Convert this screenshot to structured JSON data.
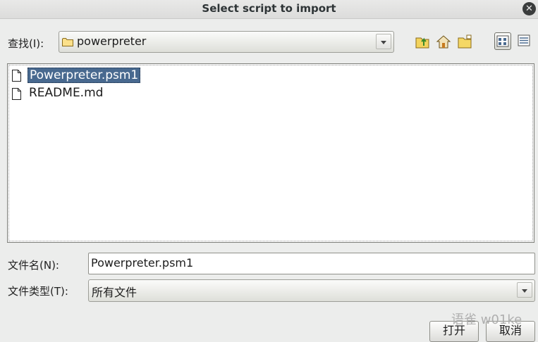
{
  "dialog": {
    "title": "Select script to import",
    "close_icon": "close-icon"
  },
  "lookin": {
    "label": "查找(I):",
    "current_folder": "powerpreter"
  },
  "toolbar": {
    "icons": [
      "up-folder-icon",
      "home-folder-icon",
      "new-folder-icon",
      "list-view-icon",
      "details-view-icon"
    ]
  },
  "files": [
    {
      "name": "Powerpreter.psm1",
      "selected": true
    },
    {
      "name": "README.md",
      "selected": false
    }
  ],
  "filename": {
    "label": "文件名(N):",
    "value": "Powerpreter.psm1"
  },
  "filetype": {
    "label": "文件类型(T):",
    "value": "所有文件"
  },
  "buttons": {
    "open": "打开",
    "cancel": "取消"
  },
  "watermark": "语雀 w01ke"
}
